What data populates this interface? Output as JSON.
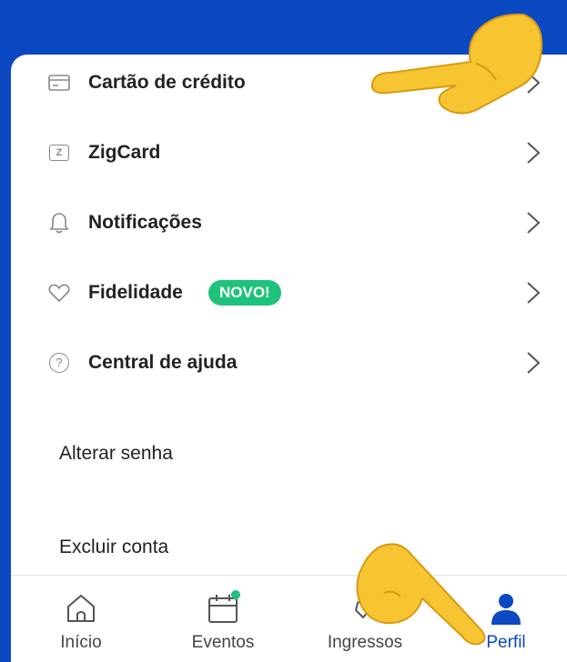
{
  "menu": {
    "items": [
      {
        "label": "Cartão de crédito",
        "icon": "credit-card-icon"
      },
      {
        "label": "ZigCard",
        "icon": "zigcard-icon",
        "icon_text": "Z"
      },
      {
        "label": "Notificações",
        "icon": "bell-icon"
      },
      {
        "label": "Fidelidade",
        "icon": "heart-icon",
        "badge": "NOVO!"
      },
      {
        "label": "Central de ajuda",
        "icon": "help-icon",
        "icon_text": "?"
      }
    ],
    "change_password": "Alterar senha",
    "delete_account": "Excluir conta"
  },
  "tabs": [
    {
      "label": "Início",
      "icon": "home-icon"
    },
    {
      "label": "Eventos",
      "icon": "calendar-icon"
    },
    {
      "label": "Ingressos",
      "icon": "ticket-icon"
    },
    {
      "label": "Perfil",
      "icon": "user-icon",
      "active": true
    }
  ],
  "colors": {
    "brand": "#0a49c2",
    "badge": "#1fc27a",
    "notification_dot": "#1fc27a"
  },
  "overlays": [
    "pointing-hand-emoji",
    "pointing-hand-emoji"
  ]
}
